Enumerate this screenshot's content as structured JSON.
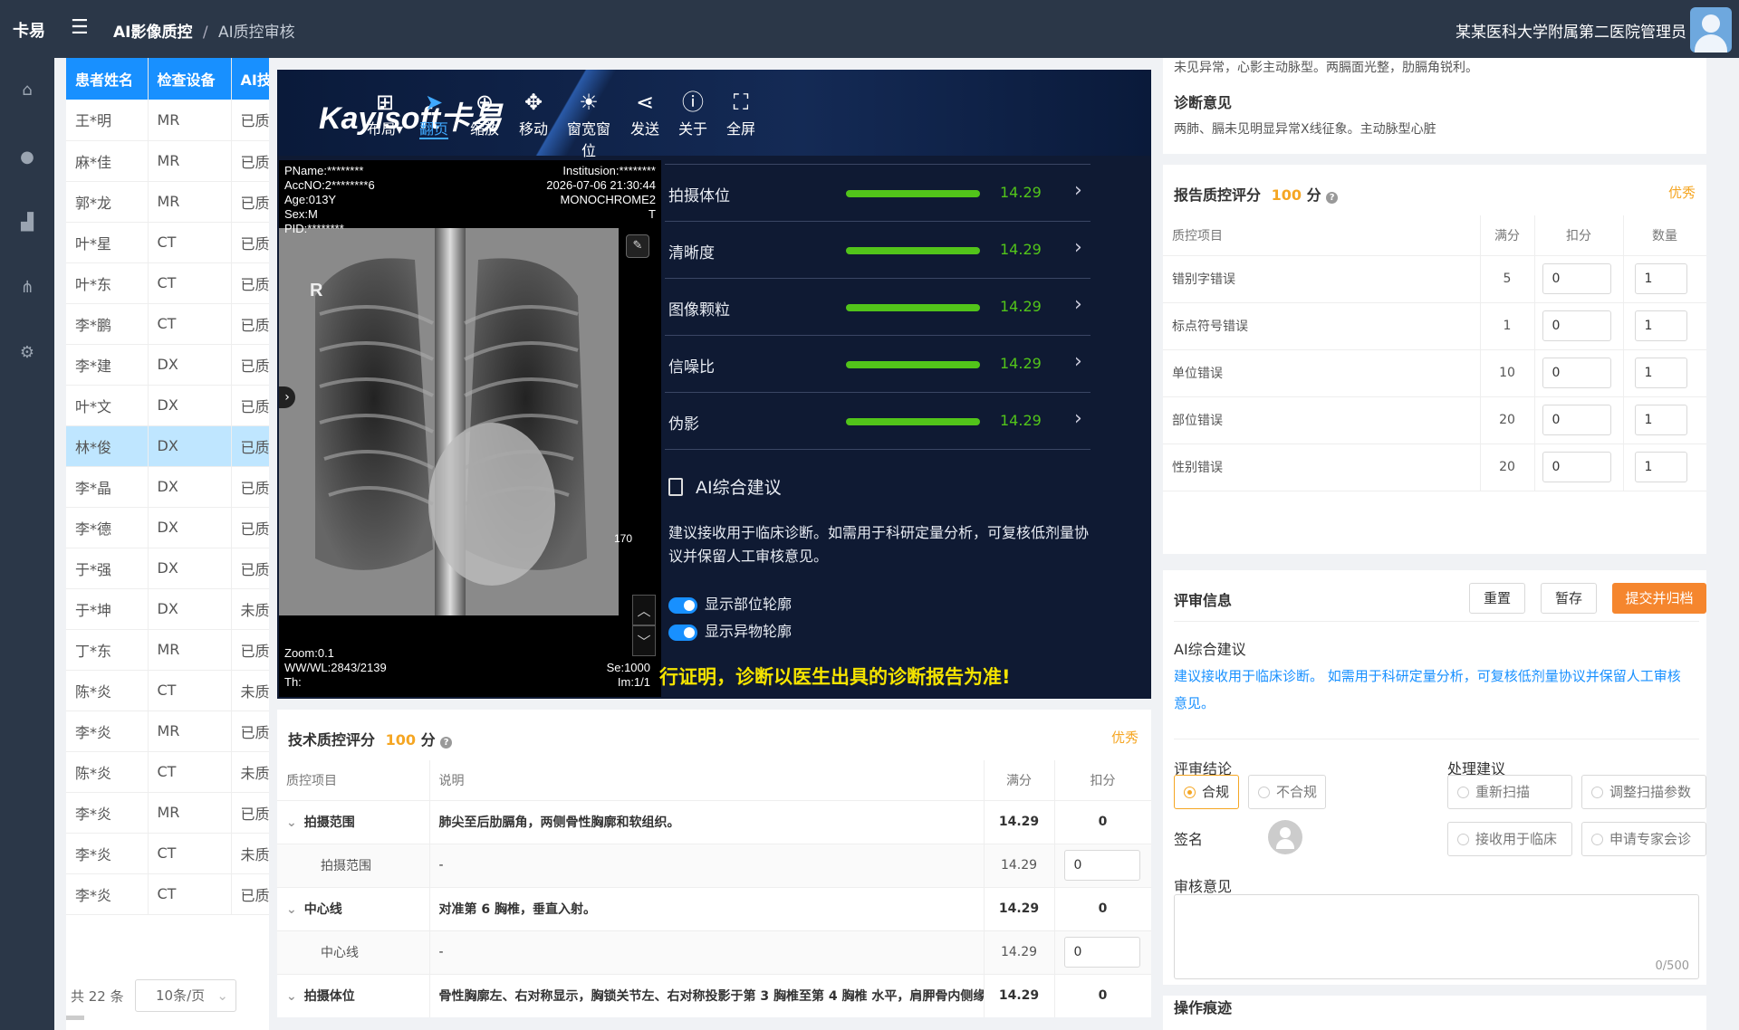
{
  "topbar": {
    "logo": "卡易",
    "breadcrumb_main": "AI影像质控",
    "breadcrumb_sep": "/",
    "breadcrumb_sub": "AI质控审核",
    "hospital": "某某医科大学附属第二医院",
    "user": "管理员"
  },
  "sidebar": {
    "icons": [
      "home-icon",
      "user-icon",
      "chart-icon",
      "org-icon",
      "settings-icon"
    ]
  },
  "patient_list": {
    "headers": [
      "患者姓名",
      "检查设备",
      "AI技"
    ],
    "rows": [
      {
        "name": "王*明",
        "device": "MR",
        "status": "已质",
        "ok": true
      },
      {
        "name": "麻*佳",
        "device": "MR",
        "status": "已质",
        "ok": true
      },
      {
        "name": "郭*龙",
        "device": "MR",
        "status": "已质",
        "ok": true
      },
      {
        "name": "叶*星",
        "device": "CT",
        "status": "已质",
        "ok": true
      },
      {
        "name": "叶*东",
        "device": "CT",
        "status": "已质",
        "ok": true
      },
      {
        "name": "李*鹏",
        "device": "CT",
        "status": "已质",
        "ok": true
      },
      {
        "name": "李*建",
        "device": "DX",
        "status": "已质",
        "ok": true
      },
      {
        "name": "叶*文",
        "device": "DX",
        "status": "已质",
        "ok": true
      },
      {
        "name": "林*俊",
        "device": "DX",
        "status": "已质",
        "ok": true
      },
      {
        "name": "李*晶",
        "device": "DX",
        "status": "已质",
        "ok": true
      },
      {
        "name": "李*德",
        "device": "DX",
        "status": "已质",
        "ok": true
      },
      {
        "name": "于*强",
        "device": "DX",
        "status": "已质",
        "ok": true
      },
      {
        "name": "于*坤",
        "device": "DX",
        "status": "未质",
        "ok": false
      },
      {
        "name": "丁*东",
        "device": "MR",
        "status": "已质",
        "ok": true
      },
      {
        "name": "陈*炎",
        "device": "CT",
        "status": "未质",
        "ok": false
      },
      {
        "name": "李*炎",
        "device": "MR",
        "status": "已质",
        "ok": true
      },
      {
        "name": "陈*炎",
        "device": "CT",
        "status": "未质",
        "ok": false
      },
      {
        "name": "李*炎",
        "device": "MR",
        "status": "已质",
        "ok": true
      },
      {
        "name": "李*炎",
        "device": "CT",
        "status": "未质",
        "ok": false
      },
      {
        "name": "李*炎",
        "device": "CT",
        "status": "已质",
        "ok": true
      }
    ],
    "total": "共 22 条",
    "page_size": "10条/页"
  },
  "viewer": {
    "brand": "Kayisoft卡易",
    "tools": [
      {
        "label": "布局▾",
        "icon": "grid-icon"
      },
      {
        "label": "翻页",
        "icon": "cursor-icon"
      },
      {
        "label": "缩放",
        "icon": "zoom-icon"
      },
      {
        "label": "移动",
        "icon": "move-icon"
      },
      {
        "label": "窗宽窗位",
        "icon": "brightness-icon"
      },
      {
        "label": "发送",
        "icon": "share-icon"
      },
      {
        "label": "关于",
        "icon": "help-icon"
      },
      {
        "label": "全屏",
        "icon": "fullscreen-icon"
      }
    ],
    "overlay_tl": [
      "PName:********",
      "AccNO:2********6",
      "Age:013Y",
      "Sex:M",
      "PID:********"
    ],
    "overlay_tr": [
      "Institusion:********",
      "2026-07-06 21:30:44",
      "MONOCHROME2",
      "T"
    ],
    "overlay_bl": [
      "Zoom:0.1",
      "WW/WL:2843/2139",
      "Th:"
    ],
    "overlay_br": [
      "Se:1000",
      "Im:1/1"
    ],
    "marker_r": "R",
    "scale_label": "170",
    "metrics": [
      {
        "label": "拍摄体位",
        "value": "14.29"
      },
      {
        "label": "清晰度",
        "value": "14.29"
      },
      {
        "label": "图像颗粒",
        "value": "14.29"
      },
      {
        "label": "信噪比",
        "value": "14.29"
      },
      {
        "label": "伪影",
        "value": "14.29"
      }
    ],
    "ai_title": "AI综合建议",
    "ai_text": "建议接收用于临床诊断。如需用于科研定量分析，可复核低剂量协议并保留人工审核意见。",
    "toggle1": "显示部位轮廓",
    "toggle2": "显示异物轮廓",
    "disclaimer": "行证明，诊断以医生出具的诊断报告为准!"
  },
  "tech": {
    "title": "技术质控评分",
    "score": "100",
    "unit": "分",
    "grade": "优秀",
    "headers": [
      "质控项目",
      "说明",
      "满分",
      "扣分"
    ],
    "rows": [
      {
        "item": "拍摄范围",
        "desc": "肺尖至后肋膈角，两侧骨性胸廓和软组织。",
        "full": "14.29",
        "deduct": "0",
        "group": true
      },
      {
        "item": "拍摄范围",
        "desc": "-",
        "full": "14.29",
        "deduct": "0",
        "group": false
      },
      {
        "item": "中心线",
        "desc": "对准第 6 胸椎，垂直入射。",
        "full": "14.29",
        "deduct": "0",
        "group": true
      },
      {
        "item": "中心线",
        "desc": "-",
        "full": "14.29",
        "deduct": "0",
        "group": false
      },
      {
        "item": "拍摄体位",
        "desc": "骨性胸廓左、右对称显示，胸锁关节左、右对称投影于第 3 胸椎至第 4 胸椎 水平，肩胛骨内侧缘投",
        "full": "14.29",
        "deduct": "0",
        "group": true
      }
    ]
  },
  "report": {
    "top_line": "未见异常，心影主动脉型。两膈面光整，肋膈角锐利。",
    "diag_title": "诊断意见",
    "diag_text": "两肺、膈未见明显异常X线征象。主动脉型心脏",
    "qc_title": "报告质控评分",
    "qc_score": "100",
    "qc_unit": "分",
    "qc_grade": "优秀",
    "qc_headers": [
      "质控项目",
      "满分",
      "扣分",
      "数量"
    ],
    "qc_rows": [
      {
        "item": "错别字错误",
        "full": "5",
        "deduct": "0",
        "count": "1"
      },
      {
        "item": "标点符号错误",
        "full": "1",
        "deduct": "0",
        "count": "1"
      },
      {
        "item": "单位错误",
        "full": "10",
        "deduct": "0",
        "count": "1"
      },
      {
        "item": "部位错误",
        "full": "20",
        "deduct": "0",
        "count": "1"
      },
      {
        "item": "性别错误",
        "full": "20",
        "deduct": "0",
        "count": "1"
      }
    ]
  },
  "review": {
    "title": "评审信息",
    "reset": "重置",
    "save": "暂存",
    "submit": "提交并归档",
    "ai_label": "AI综合建议",
    "ai_text": "建议接收用于临床诊断。 如需用于科研定量分析，可复核低剂量协议并保留人工审核意见。",
    "conclusion_label": "评审结论",
    "conclusion_ok": "合规",
    "conclusion_bad": "不合规",
    "action_label": "处理建议",
    "actions": [
      "重新扫描",
      "调整扫描参数",
      "接收用于临床",
      "申请专家会诊"
    ],
    "sign_label": "签名",
    "opinion_label": "审核意见",
    "counter": "0/500",
    "trace_title": "操作痕迹"
  },
  "colors": {
    "accent": "#1890ff",
    "ok": "#52c41a",
    "warn": "#f5a623",
    "danger": "#f5222d",
    "dark": "#2b3748"
  }
}
